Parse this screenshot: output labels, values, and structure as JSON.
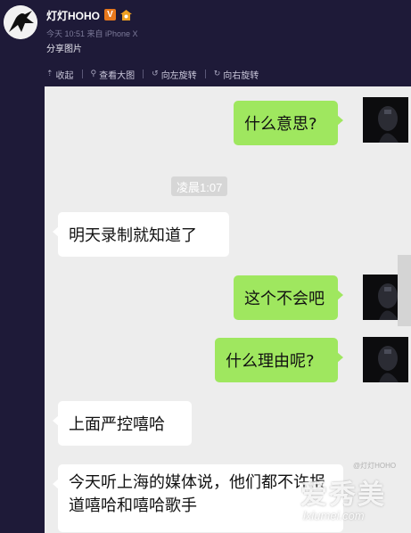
{
  "post": {
    "username": "灯灯HOHO",
    "verified_badge": "V",
    "meta": "今天 10:51 来自 iPhone X",
    "share_text": "分享图片"
  },
  "toolbar": {
    "items": [
      {
        "label": "收起",
        "icon": "collapse-icon"
      },
      {
        "label": "查看大图",
        "icon": "zoom-icon"
      },
      {
        "label": "向左旋转",
        "icon": "rotate-left-icon"
      },
      {
        "label": "向右旋转",
        "icon": "rotate-right-icon"
      }
    ]
  },
  "chat": {
    "time_divider": "凌晨1:07",
    "messages": [
      {
        "side": "me",
        "text": "什么意思?"
      },
      {
        "side": "them",
        "text": "明天录制就知道了"
      },
      {
        "side": "me",
        "text": "这个不会吧"
      },
      {
        "side": "me",
        "text": "什么理由呢?"
      },
      {
        "side": "them",
        "text": "上面严控嘻哈"
      },
      {
        "side": "them",
        "text": "今天听上海的媒体说，他们都不许报道嘻哈和嘻哈歌手"
      }
    ]
  },
  "watermark": {
    "cn": "爱秀美",
    "en": "lxiumei.com",
    "weibo": "@灯灯HOHO"
  },
  "colors": {
    "background": "#1e1a38",
    "chat_bg": "#ededed",
    "bubble_me": "#9fe75f",
    "bubble_them": "#ffffff",
    "badge": "#e8781c"
  }
}
